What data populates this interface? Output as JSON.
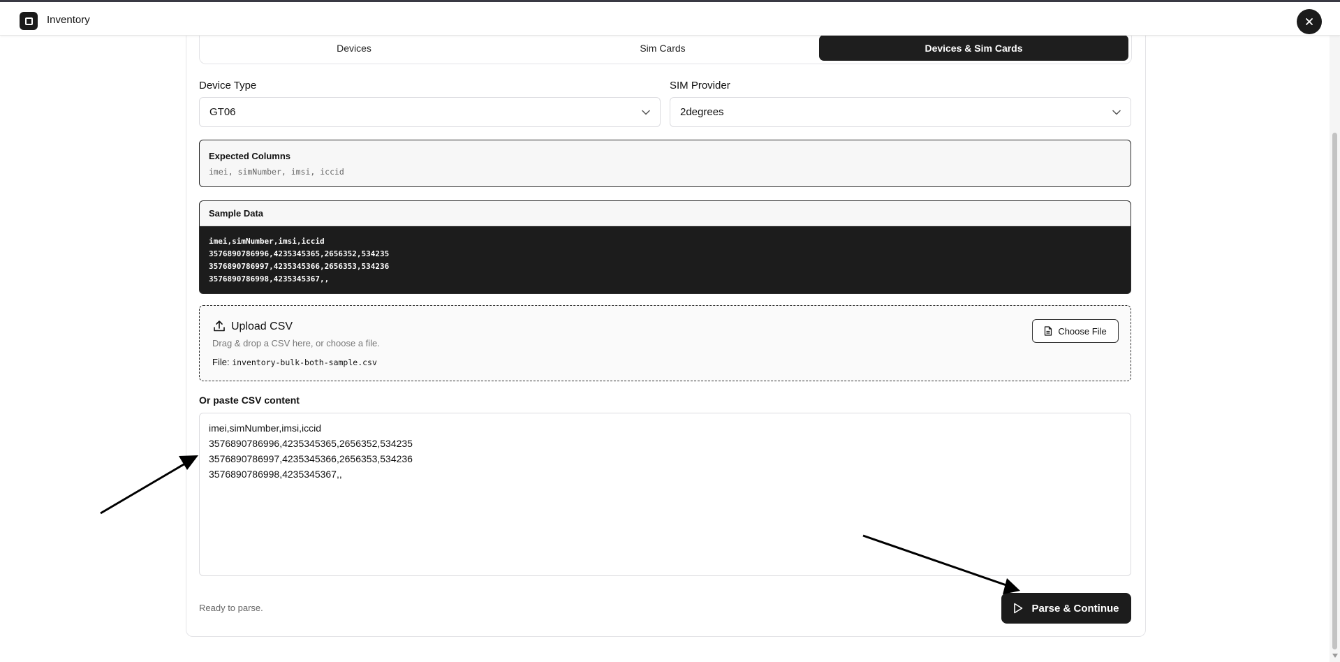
{
  "header": {
    "title": "Inventory"
  },
  "tabs": [
    {
      "label": "Devices"
    },
    {
      "label": "Sim Cards"
    },
    {
      "label": "Devices & Sim Cards"
    }
  ],
  "device_type": {
    "label": "Device Type",
    "value": "GT06"
  },
  "sim_provider": {
    "label": "SIM Provider",
    "value": "2degrees"
  },
  "expected_columns": {
    "title": "Expected Columns",
    "columns": "imei, simNumber, imsi, iccid"
  },
  "sample_data": {
    "title": "Sample Data",
    "lines": [
      "imei,simNumber,imsi,iccid",
      "3576890786996,4235345365,2656352,534235",
      "3576890786997,4235345366,2656353,534236",
      "3576890786998,4235345367,,"
    ]
  },
  "upload": {
    "title": "Upload CSV",
    "hint": "Drag & drop a CSV here, or choose a file.",
    "file_label": "File:",
    "file_name": "inventory-bulk-both-sample.csv",
    "choose_label": "Choose File"
  },
  "paste": {
    "label": "Or paste CSV content",
    "lines": [
      "imei,simNumber,imsi,iccid",
      "3576890786996,4235345365,2656352,534235",
      "3576890786997,4235345366,2656353,534236",
      "3576890786998,4235345367,,"
    ]
  },
  "status": "Ready to parse.",
  "actions": {
    "parse_label": "Parse & Continue"
  }
}
